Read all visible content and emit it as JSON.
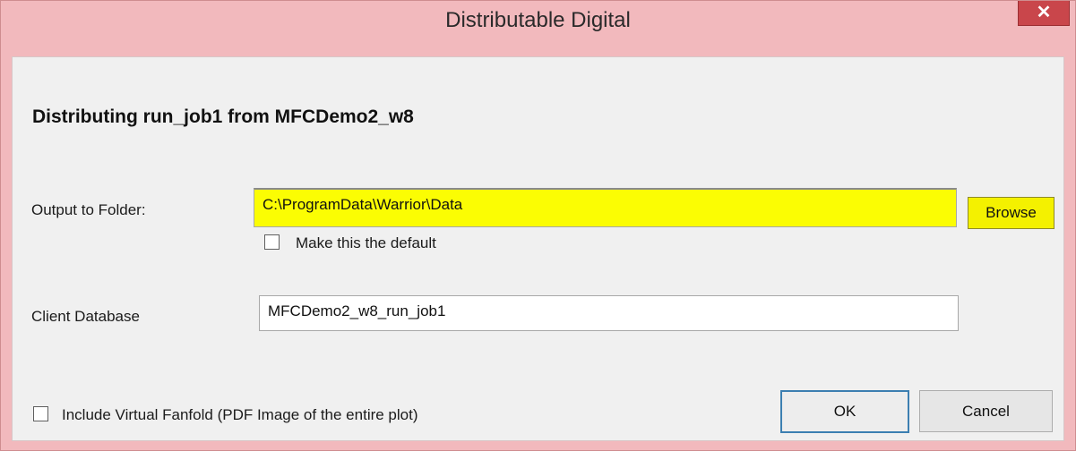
{
  "window": {
    "title": "Distributable Digital",
    "close_glyph": "✕"
  },
  "dialog": {
    "heading": "Distributing run_job1 from MFCDemo2_w8",
    "output_folder": {
      "label": "Output to Folder:",
      "value": "C:\\ProgramData\\Warrior\\Data",
      "browse_label": "Browse",
      "highlight_color": "#fbfd03"
    },
    "default_checkbox": {
      "label": "Make this the default",
      "checked": false
    },
    "client_database": {
      "label": "Client Database",
      "value": "MFCDemo2_w8_run_job1"
    },
    "fanfold_checkbox": {
      "label": "Include Virtual Fanfold (PDF Image of the entire plot)",
      "checked": false
    },
    "ok_label": "OK",
    "cancel_label": "Cancel"
  },
  "colors": {
    "title_bar": "#f2b9bd",
    "close_button": "#c9464b",
    "dialog_background": "#f0f0f0"
  }
}
